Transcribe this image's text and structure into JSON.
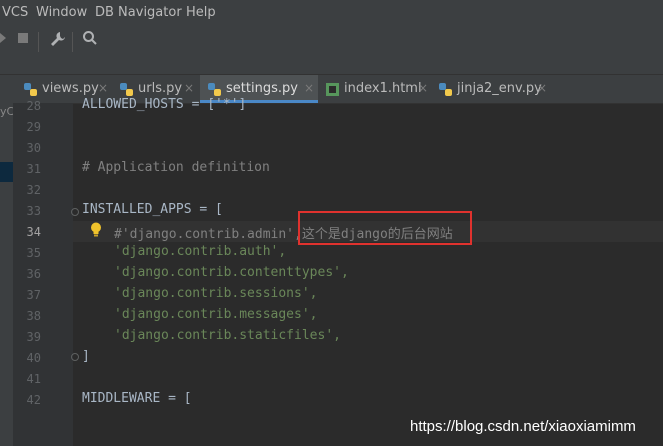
{
  "menu": {
    "vcs": "VCS",
    "window": "Window",
    "db": "DB Navigator",
    "help": "Help"
  },
  "tabs": [
    {
      "label": "views.py",
      "close": "×"
    },
    {
      "label": "urls.py",
      "close": "×"
    },
    {
      "label": "settings.py",
      "close": "×"
    },
    {
      "label": "index1.html",
      "close": "×"
    },
    {
      "label": "jinja2_env.py",
      "close": "×"
    }
  ],
  "left_panel": {
    "fragment": "yC"
  },
  "lines": [
    {
      "num": "28",
      "text": "ALLOWED_HOSTS = ['*']"
    },
    {
      "num": "29",
      "text": ""
    },
    {
      "num": "30",
      "text": ""
    },
    {
      "num": "31",
      "text": "# Application definition"
    },
    {
      "num": "32",
      "text": ""
    },
    {
      "num": "33",
      "text": "INSTALLED_APPS = ["
    },
    {
      "num": "34",
      "text": "#'django.contrib.admin',这个是django的后台网站"
    },
    {
      "num": "35",
      "text": "'django.contrib.auth',"
    },
    {
      "num": "36",
      "text": "'django.contrib.contenttypes',"
    },
    {
      "num": "37",
      "text": "'django.contrib.sessions',"
    },
    {
      "num": "38",
      "text": "'django.contrib.messages',"
    },
    {
      "num": "39",
      "text": "'django.contrib.staticfiles',"
    },
    {
      "num": "40",
      "text": "]"
    },
    {
      "num": "41",
      "text": ""
    },
    {
      "num": "42",
      "text": "MIDDLEWARE = ["
    }
  ],
  "colors": {
    "bg": "#2b2b2b",
    "string": "#6a8759",
    "comment": "#808080",
    "annotation": "#e0322e",
    "active_tab_accent": "#4a88c7"
  },
  "icons": {
    "wrench": "wrench-icon",
    "search": "search-icon",
    "bulb": "lightbulb-icon",
    "stop": "stop-icon"
  },
  "watermark": "https://blog.csdn.net/xiaoxiamimm"
}
